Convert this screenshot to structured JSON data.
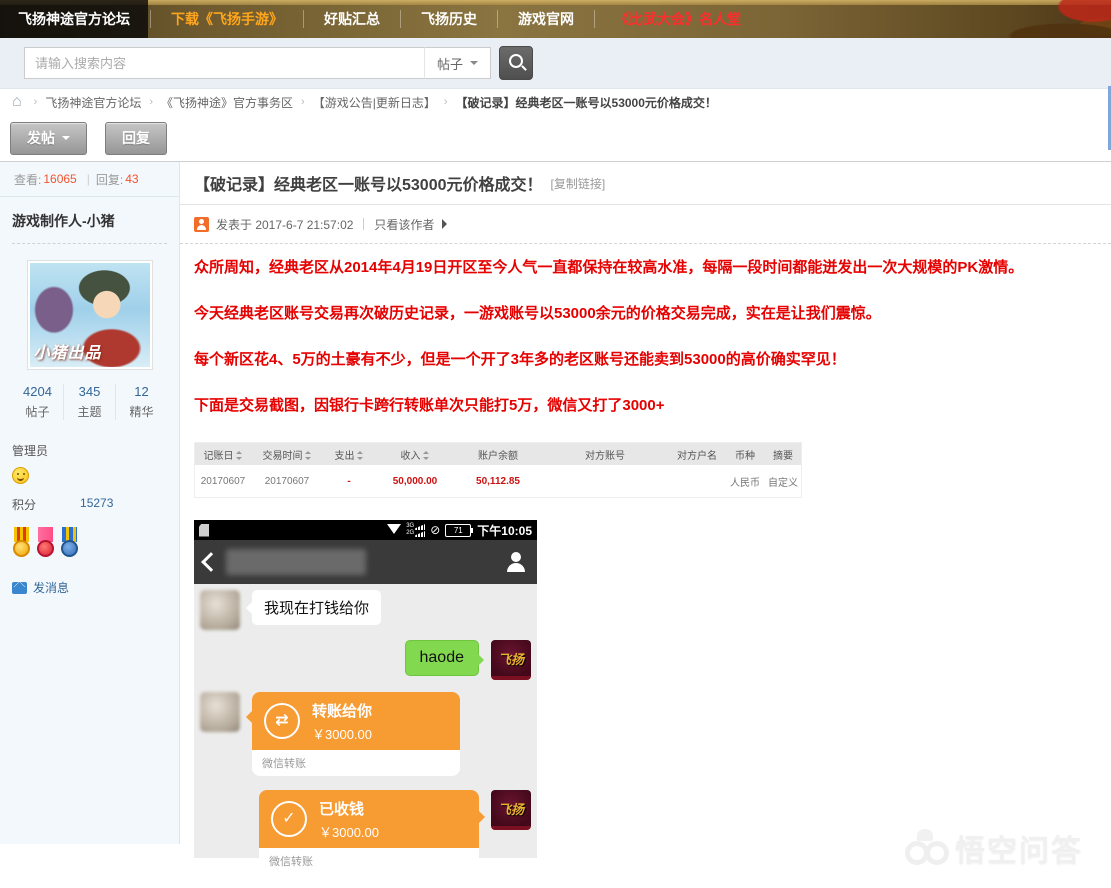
{
  "nav": {
    "items": [
      {
        "label": "飞扬神途官方论坛",
        "style": "active"
      },
      {
        "label": "下载《飞扬手游》",
        "style": "orange"
      },
      {
        "label": "好贴汇总",
        "style": "normal"
      },
      {
        "label": "飞扬历史",
        "style": "normal"
      },
      {
        "label": "游戏官网",
        "style": "normal"
      },
      {
        "label": "《比武大会》名人堂",
        "style": "red"
      }
    ]
  },
  "search": {
    "placeholder": "请输入搜索内容",
    "category": "帖子"
  },
  "breadcrumb": {
    "items": [
      "飞扬神途官方论坛",
      "《飞扬神途》官方事务区",
      "【游戏公告|更新日志】",
      "【破记录】经典老区一账号以53000元价格成交！"
    ]
  },
  "actions": {
    "post": "发帖",
    "reply": "回复"
  },
  "thread": {
    "views_label": "查看:",
    "views": "16065",
    "replies_label": "回复:",
    "replies": "43"
  },
  "author": {
    "name": "游戏制作人-小猪",
    "avatar_caption": "小猪出品",
    "stats": [
      {
        "value": "4204",
        "label": "帖子"
      },
      {
        "value": "345",
        "label": "主题"
      },
      {
        "value": "12",
        "label": "精华"
      }
    ],
    "role": "管理员",
    "score_label": "积分",
    "score": "15273",
    "send_message": "发消息"
  },
  "post": {
    "title": "【破记录】经典老区一账号以53000元价格成交！",
    "copy_link": "[复制链接]",
    "posted_at": "发表于 2017-6-7 21:57:02",
    "only_author": "只看该作者",
    "paragraphs": [
      "众所周知，经典老区从2014年4月19日开区至今人气一直都保持在较高水准，每隔一段时间都能迸发出一次大规模的PK激情。",
      "今天经典老区账号交易再次破历史记录，一游戏账号以53000余元的价格交易完成，实在是让我们震惊。",
      "每个新区花4、5万的土豪有不少，但是一个开了3年多的老区账号还能卖到53000的高价确实罕见！",
      "下面是交易截图，因银行卡跨行转账单次只能打5万，微信又打了3000+"
    ]
  },
  "bank_table": {
    "headers": [
      {
        "label": "记账日",
        "sortable": true
      },
      {
        "label": "交易时间",
        "sortable": true
      },
      {
        "label": "支出",
        "sortable": true
      },
      {
        "label": "收入",
        "sortable": true
      },
      {
        "label": "账户余额",
        "sortable": false
      },
      {
        "label": "对方账号",
        "sortable": false
      },
      {
        "label": "对方户名",
        "sortable": false
      },
      {
        "label": "币种",
        "sortable": false
      },
      {
        "label": "摘要",
        "sortable": false
      }
    ],
    "row": {
      "date": "20170607",
      "time": "20170607",
      "expense": "-",
      "income": "50,000.00",
      "balance": "50,112.85",
      "currency": "人民币",
      "summary": "自定义"
    }
  },
  "wechat": {
    "status": {
      "time": "下午10:05",
      "battery": "71",
      "net_top": "3G",
      "net_bottom": "2G"
    },
    "messages": {
      "incoming_text": "我现在打钱给你",
      "outgoing_text": "haode"
    },
    "transfer_sent": {
      "title": "转账给你",
      "amount": "￥3000.00",
      "source": "微信转账"
    },
    "transfer_received": {
      "title": "已收钱",
      "amount": "￥3000.00",
      "source": "微信转账"
    },
    "game_avatar_text": "飞扬"
  },
  "watermark": {
    "text": "悟空问答"
  },
  "icons": {
    "home": "⌂",
    "no_disturb": "⊘",
    "transfer": "⇄",
    "check": "✓"
  },
  "colors": {
    "accent_red_text": "#e60000",
    "wechat_orange": "#f79b33",
    "wechat_green": "#82d84f",
    "link_blue": "#336699"
  }
}
